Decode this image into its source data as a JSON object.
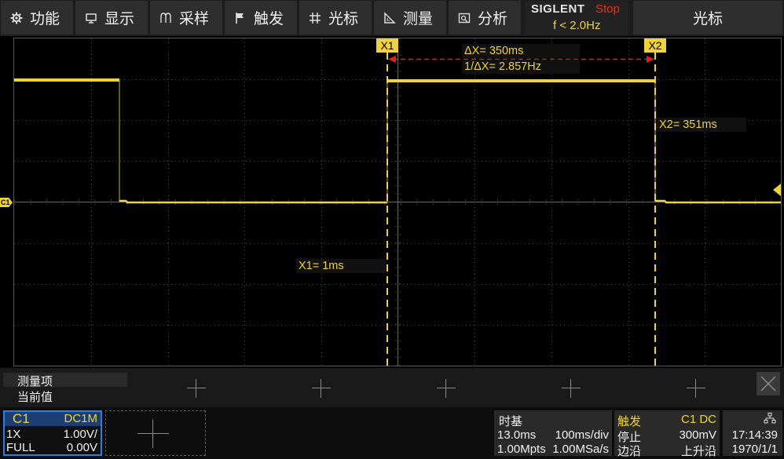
{
  "menu": {
    "items": [
      {
        "label": "功能",
        "icon": "gear-icon"
      },
      {
        "label": "显示",
        "icon": "display-icon"
      },
      {
        "label": "采样",
        "icon": "sample-icon"
      },
      {
        "label": "触发",
        "icon": "flag-icon"
      },
      {
        "label": "光标",
        "icon": "cursor-grid-icon"
      },
      {
        "label": "测量",
        "icon": "measure-icon"
      },
      {
        "label": "分析",
        "icon": "analysis-icon"
      }
    ],
    "brand": "SIGLENT",
    "run_state": "Stop",
    "frequency": "f < 2.0Hz",
    "right_title": "光标"
  },
  "scope": {
    "channel_marker": "C1",
    "cursor_x1_tag": "X1",
    "cursor_x2_tag": "X2",
    "delta_x": "ΔX= 350ms",
    "inv_delta_x": "1/ΔX= 2.857Hz",
    "x1_readout": "X1= 1ms",
    "x2_readout": "X2= 351ms",
    "colors": {
      "trace": "#f0d338",
      "grid": "#444444",
      "delta_arrow": "#e02020"
    }
  },
  "measure": {
    "title": "测量项",
    "current_value": "当前值"
  },
  "channel": {
    "name": "C1",
    "coupling": "DC1M",
    "probe": "1X",
    "scale": "1.00V/",
    "bandwidth": "FULL",
    "offset": "0.00V"
  },
  "timebase": {
    "title": "时基",
    "delay": "13.0ms",
    "scale": "100ms/div",
    "memory_depth": "1.00Mpts",
    "sample_rate": "1.00MSa/s"
  },
  "trigger": {
    "title": "触发",
    "source": "C1 DC",
    "state": "停止",
    "level": "300mV",
    "type": "边沿",
    "slope": "上升沿"
  },
  "clock": {
    "time": "17:14:39",
    "date": "1970/1/1"
  }
}
